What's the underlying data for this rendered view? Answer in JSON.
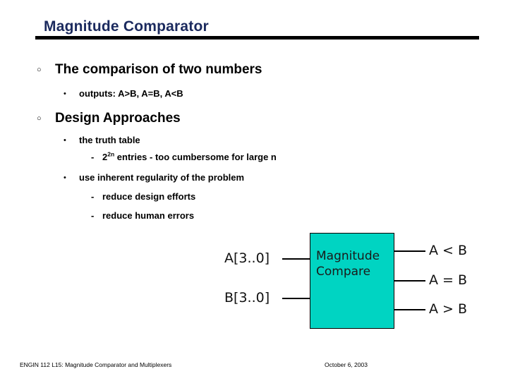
{
  "slide": {
    "title": "Magnitude Comparator",
    "accent_rule_color": "#000000",
    "title_color": "#1b2a5e",
    "box_color": "#00d4c2"
  },
  "bullets": {
    "b1": {
      "marker": "○",
      "text": "The comparison of two numbers"
    },
    "b1_sub1": {
      "marker": "•",
      "text": "outputs: A>B, A=B, A<B"
    },
    "b2": {
      "marker": "○",
      "text": "Design Approaches"
    },
    "b2_sub1": {
      "marker": "•",
      "text": "the truth table"
    },
    "b2_sub1_a": {
      "marker": "-",
      "base": "2",
      "exponent": "2n",
      "tail": " entries - too cumbersome for large n"
    },
    "b2_sub2": {
      "marker": "•",
      "text": "use inherent regularity of the problem"
    },
    "b2_sub2_a": {
      "marker": "-",
      "text": "reduce design efforts"
    },
    "b2_sub2_b": {
      "marker": "-",
      "text": "reduce human errors"
    }
  },
  "diagram": {
    "block_label_line1": "Magnitude",
    "block_label_line2": "Compare",
    "input_a": "A[3..0]",
    "input_b": "B[3..0]",
    "output_lt": "A < B",
    "output_eq": "A = B",
    "output_gt": "A > B"
  },
  "footer": {
    "course": "ENGIN 112  L15: Magnitude Comparator and Multiplexers",
    "date": "October 6, 2003"
  }
}
